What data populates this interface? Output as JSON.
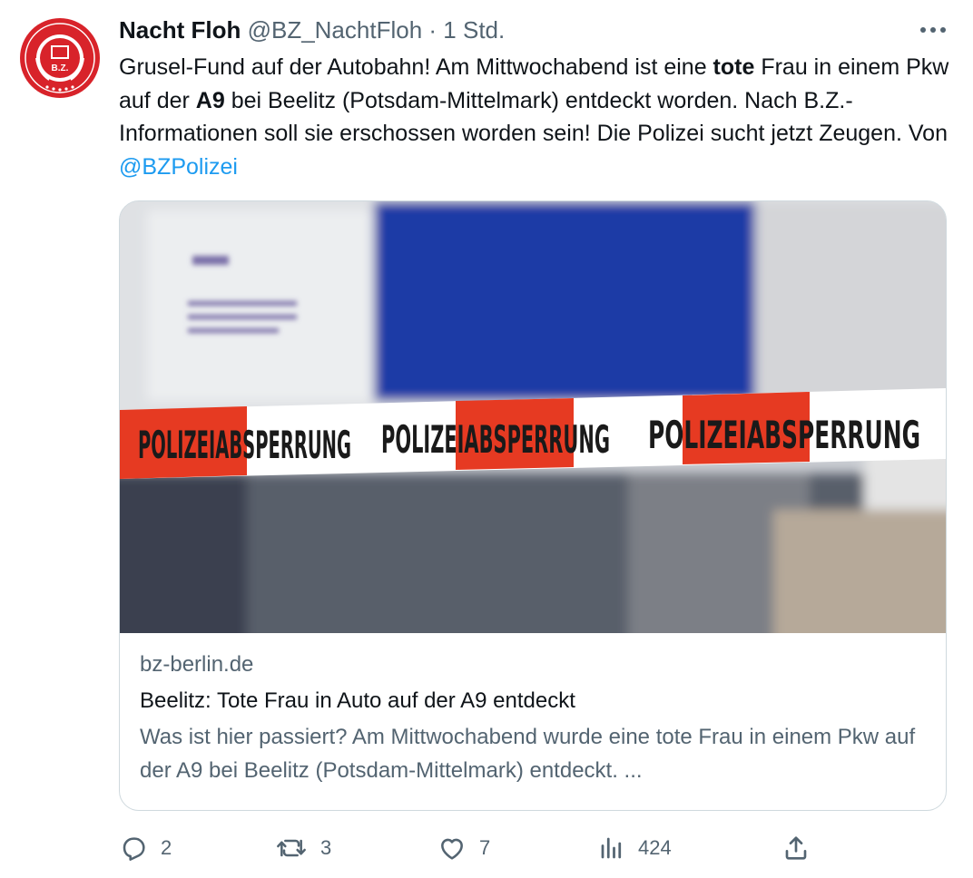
{
  "author": {
    "name": "Nacht Floh",
    "handle": "@BZ_NachtFloh",
    "separator": "·",
    "time": "1 Std.",
    "avatar_logo_text": "BERLINS HÄRTESTE POLIZEI REDAKTION",
    "avatar_logo_mark": "B.Z."
  },
  "tweet": {
    "segments": [
      "Grusel-Fund auf der Autobahn! Am Mittwochabend ist eine ",
      "tote",
      " Frau in einem Pkw auf der ",
      "A9",
      " bei Beelitz (Potsdam-Mittelmark) entdeckt worden. Nach B.Z.-Informationen soll sie erschossen worden sein! Die Polizei sucht jetzt Zeugen. Von ",
      "@BZPolizei"
    ]
  },
  "card": {
    "image_tape_text": "POLIZEIABSPERRUNG",
    "domain": "bz-berlin.de",
    "title": "Beelitz: Tote Frau in Auto auf der A9 entdeckt",
    "description": "Was ist hier passiert? Am Mittwochabend wurde eine tote Frau in einem Pkw auf der A9 bei Beelitz (Potsdam-Mittelmark) entdeckt. ..."
  },
  "actions": {
    "replies": "2",
    "reposts": "3",
    "likes": "7",
    "views": "424"
  },
  "icons": {
    "more": "more-horizontal-icon",
    "reply": "reply-icon",
    "repost": "repost-icon",
    "like": "heart-icon",
    "views": "views-chart-icon",
    "share": "share-icon"
  },
  "colors": {
    "accent": "#1d9bf0",
    "text": "#0f1419",
    "secondary": "#536471",
    "border": "#cfd9de",
    "logo_red": "#d8232a",
    "tape_red": "#e63a22"
  }
}
